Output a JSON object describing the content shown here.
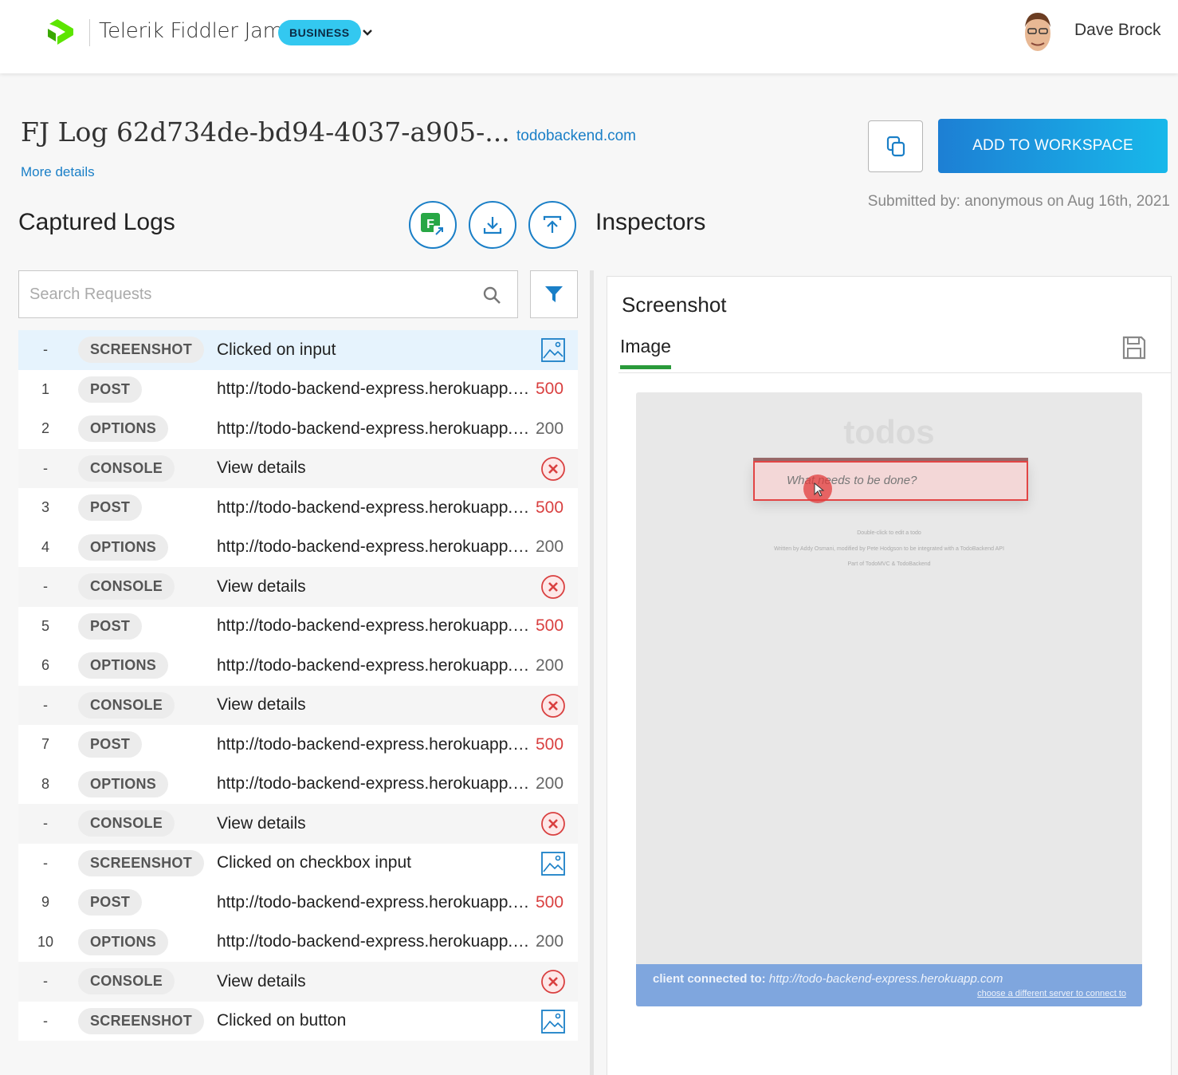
{
  "header": {
    "product_name": "Telerik Fiddler Jam",
    "plan_badge": "BUSINESS",
    "user_name": "Dave Brock"
  },
  "log": {
    "title": "FJ Log 62d734de-bd94-4037-a905-...",
    "domain": "todobackend.com",
    "more_details": "More details",
    "add_to_workspace": "ADD TO WORKSPACE",
    "submitted": "Submitted by: anonymous on Aug 16th, 2021"
  },
  "captured_logs": {
    "title": "Captured Logs",
    "search_placeholder": "Search Requests",
    "rows": [
      {
        "num": "-",
        "type": "SCREENSHOT",
        "desc": "Clicked on input",
        "status": "",
        "kind": "screenshot",
        "selected": true
      },
      {
        "num": "1",
        "type": "POST",
        "desc": "http://todo-backend-express.herokuapp.co...",
        "status": "500",
        "kind": "request"
      },
      {
        "num": "2",
        "type": "OPTIONS",
        "desc": "http://todo-backend-express.herokuapp.co...",
        "status": "200",
        "kind": "request"
      },
      {
        "num": "-",
        "type": "CONSOLE",
        "desc": "View details",
        "status": "",
        "kind": "console"
      },
      {
        "num": "3",
        "type": "POST",
        "desc": "http://todo-backend-express.herokuapp.co...",
        "status": "500",
        "kind": "request"
      },
      {
        "num": "4",
        "type": "OPTIONS",
        "desc": "http://todo-backend-express.herokuapp.co...",
        "status": "200",
        "kind": "request"
      },
      {
        "num": "-",
        "type": "CONSOLE",
        "desc": "View details",
        "status": "",
        "kind": "console"
      },
      {
        "num": "5",
        "type": "POST",
        "desc": "http://todo-backend-express.herokuapp.co...",
        "status": "500",
        "kind": "request"
      },
      {
        "num": "6",
        "type": "OPTIONS",
        "desc": "http://todo-backend-express.herokuapp.co...",
        "status": "200",
        "kind": "request"
      },
      {
        "num": "-",
        "type": "CONSOLE",
        "desc": "View details",
        "status": "",
        "kind": "console"
      },
      {
        "num": "7",
        "type": "POST",
        "desc": "http://todo-backend-express.herokuapp.co...",
        "status": "500",
        "kind": "request"
      },
      {
        "num": "8",
        "type": "OPTIONS",
        "desc": "http://todo-backend-express.herokuapp.co...",
        "status": "200",
        "kind": "request"
      },
      {
        "num": "-",
        "type": "CONSOLE",
        "desc": "View details",
        "status": "",
        "kind": "console"
      },
      {
        "num": "-",
        "type": "SCREENSHOT",
        "desc": "Clicked on checkbox input",
        "status": "",
        "kind": "screenshot"
      },
      {
        "num": "9",
        "type": "POST",
        "desc": "http://todo-backend-express.herokuapp.co...",
        "status": "500",
        "kind": "request"
      },
      {
        "num": "10",
        "type": "OPTIONS",
        "desc": "http://todo-backend-express.herokuapp.co...",
        "status": "200",
        "kind": "request"
      },
      {
        "num": "-",
        "type": "CONSOLE",
        "desc": "View details",
        "status": "",
        "kind": "console"
      },
      {
        "num": "-",
        "type": "SCREENSHOT",
        "desc": "Clicked on button",
        "status": "",
        "kind": "screenshot"
      }
    ]
  },
  "inspectors": {
    "title": "Inspectors",
    "panel_title": "Screenshot",
    "tab_image": "Image",
    "screenshot": {
      "app_title": "todos",
      "input_placeholder": "What needs to be done?",
      "footer_1": "Double-click to edit a todo",
      "footer_2": "Written by Addy Osmani, modified by Pete Hodgson to be integrated with a TodoBackend API",
      "footer_3": "Part of TodoMVC & TodoBackend",
      "client_label": "client connected to:",
      "client_url": "http://todo-backend-express.herokuapp.com",
      "change_server": "choose a different server to connect to"
    }
  },
  "colors": {
    "accent": "#1a7fc7",
    "status_error": "#d94040",
    "tab_underline": "#2a9a3a",
    "badge": "#33c8f0"
  },
  "icons": [
    "logo-icon",
    "chevron-down-icon",
    "copy-icon",
    "fiddler-icon",
    "download-icon",
    "upload-icon",
    "search-icon",
    "filter-icon",
    "image-icon",
    "error-icon",
    "save-icon"
  ]
}
